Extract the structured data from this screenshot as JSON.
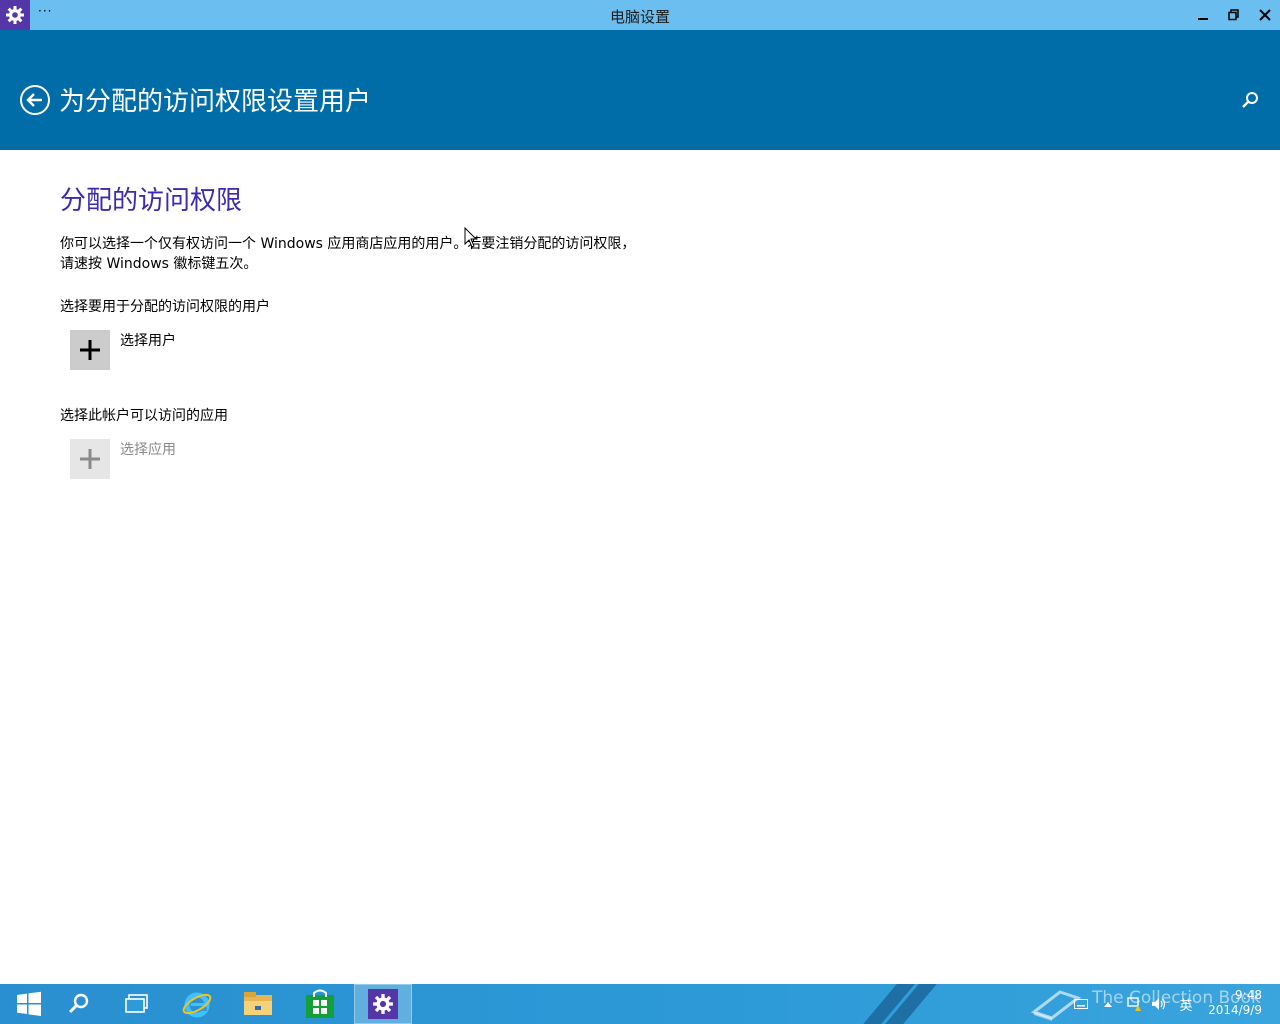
{
  "window": {
    "title": "电脑设置",
    "menu_label": "···"
  },
  "header": {
    "title": "为分配的访问权限设置用户"
  },
  "content": {
    "section_title": "分配的访问权限",
    "description": "你可以选择一个仅有权访问一个 Windows 应用商店应用的用户。若要注销分配的访问权限，请速按 Windows 徽标键五次。",
    "user_section_label": "选择要用于分配的访问权限的用户",
    "choose_user_label": "选择用户",
    "app_section_label": "选择此帐户可以访问的应用",
    "choose_app_label": "选择应用"
  },
  "taskbar": {
    "language": "英",
    "time": "9:48",
    "date": "2014/9/9",
    "watermark": "The Collection Book"
  },
  "colors": {
    "titlebar": "#6bbff0",
    "header": "#006ca8",
    "accent_title": "#3c2bb0",
    "app_icon": "#5436a7",
    "taskbar": "#2d9bd8"
  },
  "icons": [
    "gear-icon",
    "minimize-icon",
    "restore-icon",
    "close-icon",
    "back-arrow-icon",
    "search-icon",
    "plus-icon",
    "windows-start-icon",
    "ie-icon",
    "file-explorer-icon",
    "store-icon",
    "task-view-icon"
  ]
}
